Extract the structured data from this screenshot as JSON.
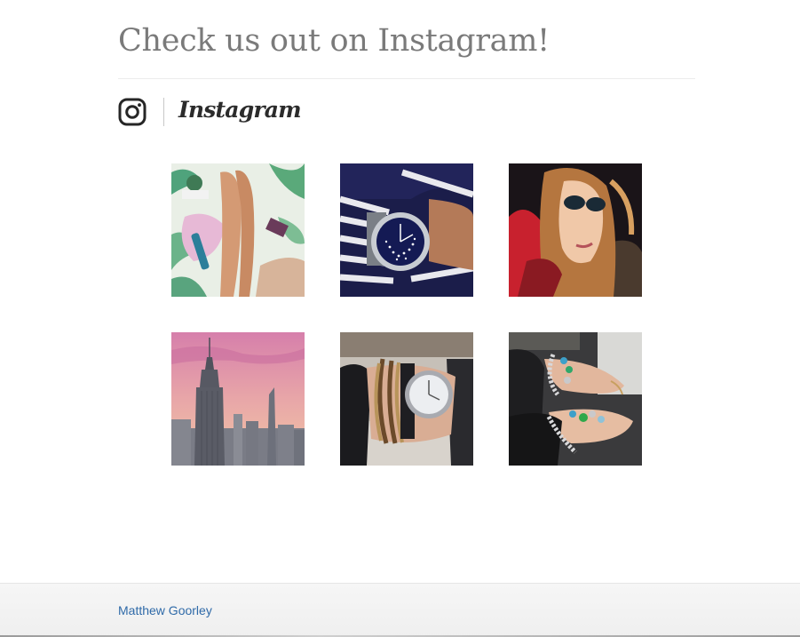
{
  "section": {
    "title": "Check us out on Instagram!"
  },
  "instagram": {
    "wordmark": "Instagram",
    "icon": "instagram-camera-icon"
  },
  "posts": [
    {
      "icon": "beach-flatlay-photo"
    },
    {
      "icon": "sparkle-watch-photo"
    },
    {
      "icon": "selfie-sunglasses-photo"
    },
    {
      "icon": "empire-state-skyline-photo"
    },
    {
      "icon": "watch-bracelets-photo"
    },
    {
      "icon": "charm-bracelets-photo"
    }
  ],
  "footer": {
    "author": "Matthew Goorley"
  },
  "colors": {
    "title": "#7a7a7a",
    "link": "#2f6aa8",
    "footer_bg": "#f3f3f3"
  }
}
